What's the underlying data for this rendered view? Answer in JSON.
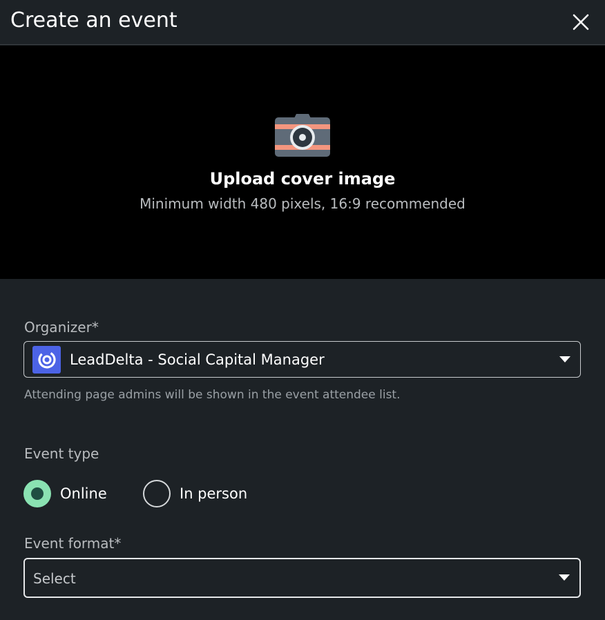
{
  "header": {
    "title": "Create an event",
    "close_icon": "close-icon"
  },
  "cover": {
    "icon": "camera-icon",
    "title": "Upload cover image",
    "subtitle": "Minimum width 480 pixels, 16:9 recommended"
  },
  "organizer": {
    "label": "Organizer*",
    "value": "LeadDelta - Social Capital Manager",
    "logo_icon": "leaddelta-logo-icon",
    "helper": "Attending page admins will be shown in the event attendee list."
  },
  "event_type": {
    "label": "Event type",
    "options": [
      {
        "label": "Online",
        "checked": true
      },
      {
        "label": "In person",
        "checked": false
      }
    ]
  },
  "event_format": {
    "label": "Event format*",
    "value": "Select"
  },
  "colors": {
    "background": "#1d2226",
    "cover_background": "#000000",
    "radio_accent": "#8ae2b2",
    "logo": "#4c63e6"
  }
}
